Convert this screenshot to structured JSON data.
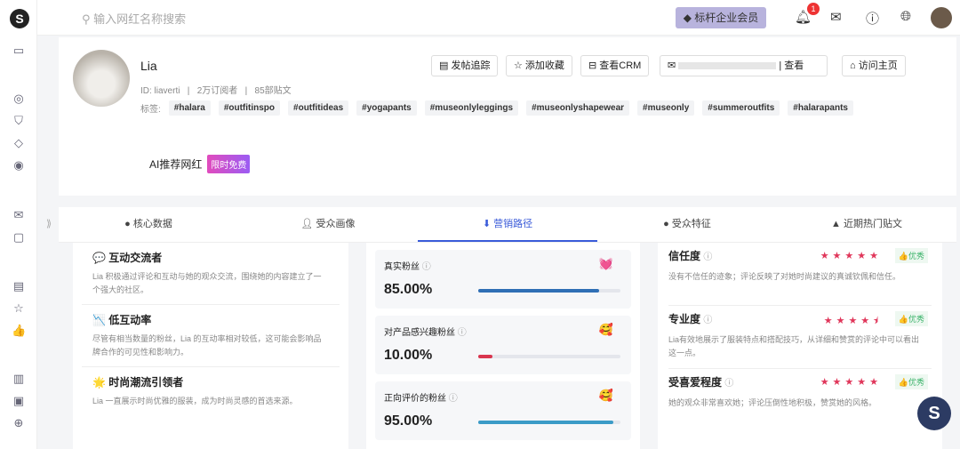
{
  "topbar": {
    "search_placeholder": "输入网红名称搜索",
    "vip_label": "标杆企业会员",
    "notif_count": "1"
  },
  "profile": {
    "name": "Lia",
    "meta": "ID: liaverti   |   2万订阅者   |   85部贴文",
    "tags_label": "标签:",
    "tags": [
      "#halara",
      "#outfitinspo",
      "#outfitideas",
      "#yogapants",
      "#museonlyleggings",
      "#museonlyshapewear",
      "#museonly",
      "#summeroutfits",
      "#halarapants"
    ],
    "buttons": {
      "track": "发帖追踪",
      "fav": "添加收藏",
      "crm": "查看CRM",
      "view": "查看",
      "home": "访问主页"
    },
    "ai_label": "AI推荐网红",
    "free_badge": "限时免费"
  },
  "tabs": [
    "核心数据",
    "受众画像",
    "营销路径",
    "受众特征",
    "近期热门贴文"
  ],
  "traits": [
    {
      "icon": "💬",
      "title": "互动交流者",
      "desc": "Lia 积极通过评论和互动与她的观众交流，围绕她的内容建立了一个强大的社区。"
    },
    {
      "icon": "📉",
      "title": "低互动率",
      "desc": "尽管有相当数量的粉丝，Lia 的互动率相对较低，这可能会影响品牌合作的可见性和影响力。"
    },
    {
      "icon": "🌟",
      "title": "时尚潮流引领者",
      "desc": "Lia 一直展示时尚优雅的服装，成为时尚灵感的首选来源。"
    }
  ],
  "stats": [
    {
      "label": "真实粉丝",
      "emoji": "💓",
      "value": "85.00%",
      "pct": 85,
      "color": "#2f6fb5"
    },
    {
      "label": "对产品感兴趣粉丝",
      "emoji": "🥰",
      "value": "10.00%",
      "pct": 10,
      "color": "#d9364f"
    },
    {
      "label": "正向评价的粉丝",
      "emoji": "🥰",
      "value": "95.00%",
      "pct": 95,
      "color": "#3b9bc7"
    }
  ],
  "ratings": [
    {
      "title": "信任度",
      "stars": "★★★★★",
      "rating": 5,
      "badge": "👍优秀",
      "desc": "没有不信任的迹象；评论反映了对她时尚建议的真诚钦佩和信任。"
    },
    {
      "title": "专业度",
      "stars": "★★★★⯨",
      "rating": 4.5,
      "badge": "👍优秀",
      "desc": "Lia有效地展示了服装特点和搭配技巧，从详细和赞赏的评论中可以看出这一点。"
    },
    {
      "title": "受喜爱程度",
      "stars": "★★★★★",
      "rating": 5,
      "badge": "👍优秀",
      "desc": "她的观众非常喜欢她；评论压倒性地积极，赞赏她的风格。"
    }
  ]
}
